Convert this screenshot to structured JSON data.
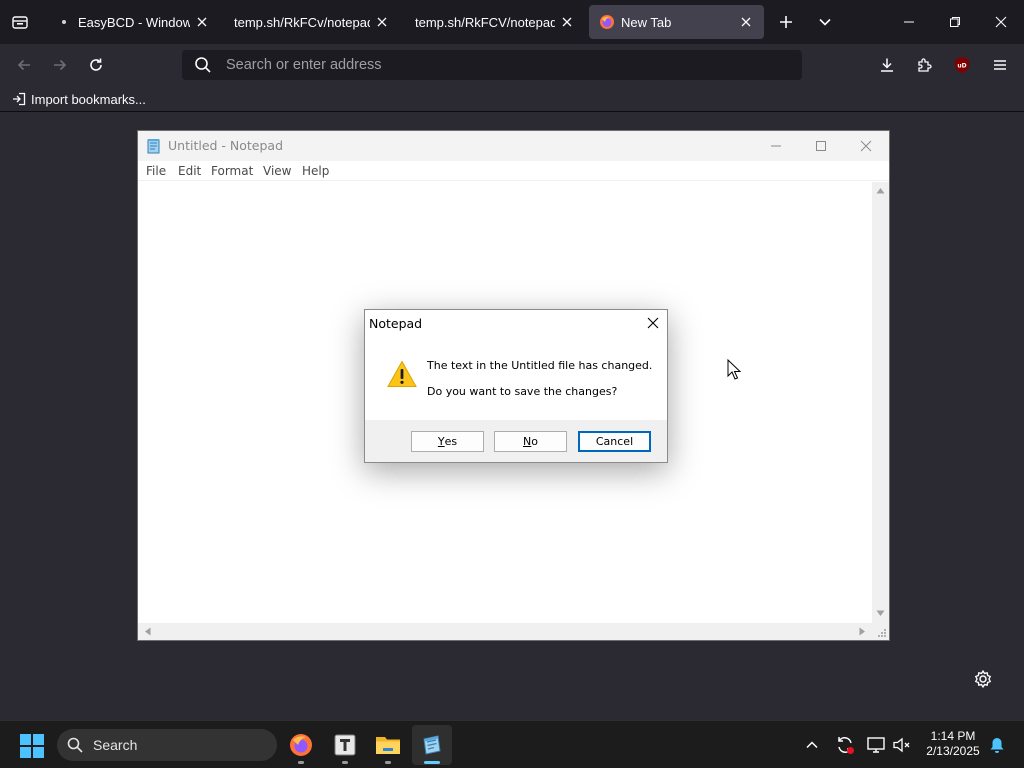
{
  "browser": {
    "tabs": [
      {
        "title": "EasyBCD - Windows Bo",
        "active": false
      },
      {
        "title": "temp.sh/RkFCv/notepad.ex",
        "active": false
      },
      {
        "title": "temp.sh/RkFCV/notepad.ex",
        "active": false
      },
      {
        "title": "New Tab",
        "active": true
      }
    ],
    "address_placeholder": "Search or enter address",
    "address_value": "",
    "bookmarks": [
      {
        "label": "Import bookmarks..."
      }
    ],
    "icons": {
      "tab_list": "tab-list-icon",
      "new_tab": "plus-icon",
      "tab_overflow": "chevron-down-icon",
      "back": "back-arrow-icon",
      "forward": "forward-arrow-icon",
      "reload": "reload-icon",
      "downloads": "download-icon",
      "extensions": "puzzle-icon",
      "ublock": "ublock-icon",
      "menu": "hamburger-icon",
      "settings": "gear-icon"
    }
  },
  "notepad": {
    "title": "Untitled - Notepad",
    "menu": [
      "File",
      "Edit",
      "Format",
      "View",
      "Help"
    ],
    "content": ""
  },
  "dialog": {
    "title": "Notepad",
    "message_line1": "The text in the Untitled file has changed.",
    "message_line2": "Do you want to save the changes?",
    "buttons": {
      "yes_rest": "es",
      "yes_mnemonic": "Y",
      "no_rest": "o",
      "no_mnemonic": "N",
      "cancel": "Cancel"
    },
    "default_button": "Cancel"
  },
  "taskbar": {
    "search_label": "Search",
    "apps": [
      "firefox",
      "typora",
      "file-explorer",
      "notepad"
    ],
    "active_app": "notepad",
    "clock": {
      "time": "1:14 PM",
      "date": "2/13/2025"
    }
  },
  "colors": {
    "chrome_dark": "#1c1b22",
    "chrome": "#2b2a33",
    "active_tab": "#42414d",
    "accent": "#0067c0",
    "taskbar": "#1c1c1c"
  }
}
